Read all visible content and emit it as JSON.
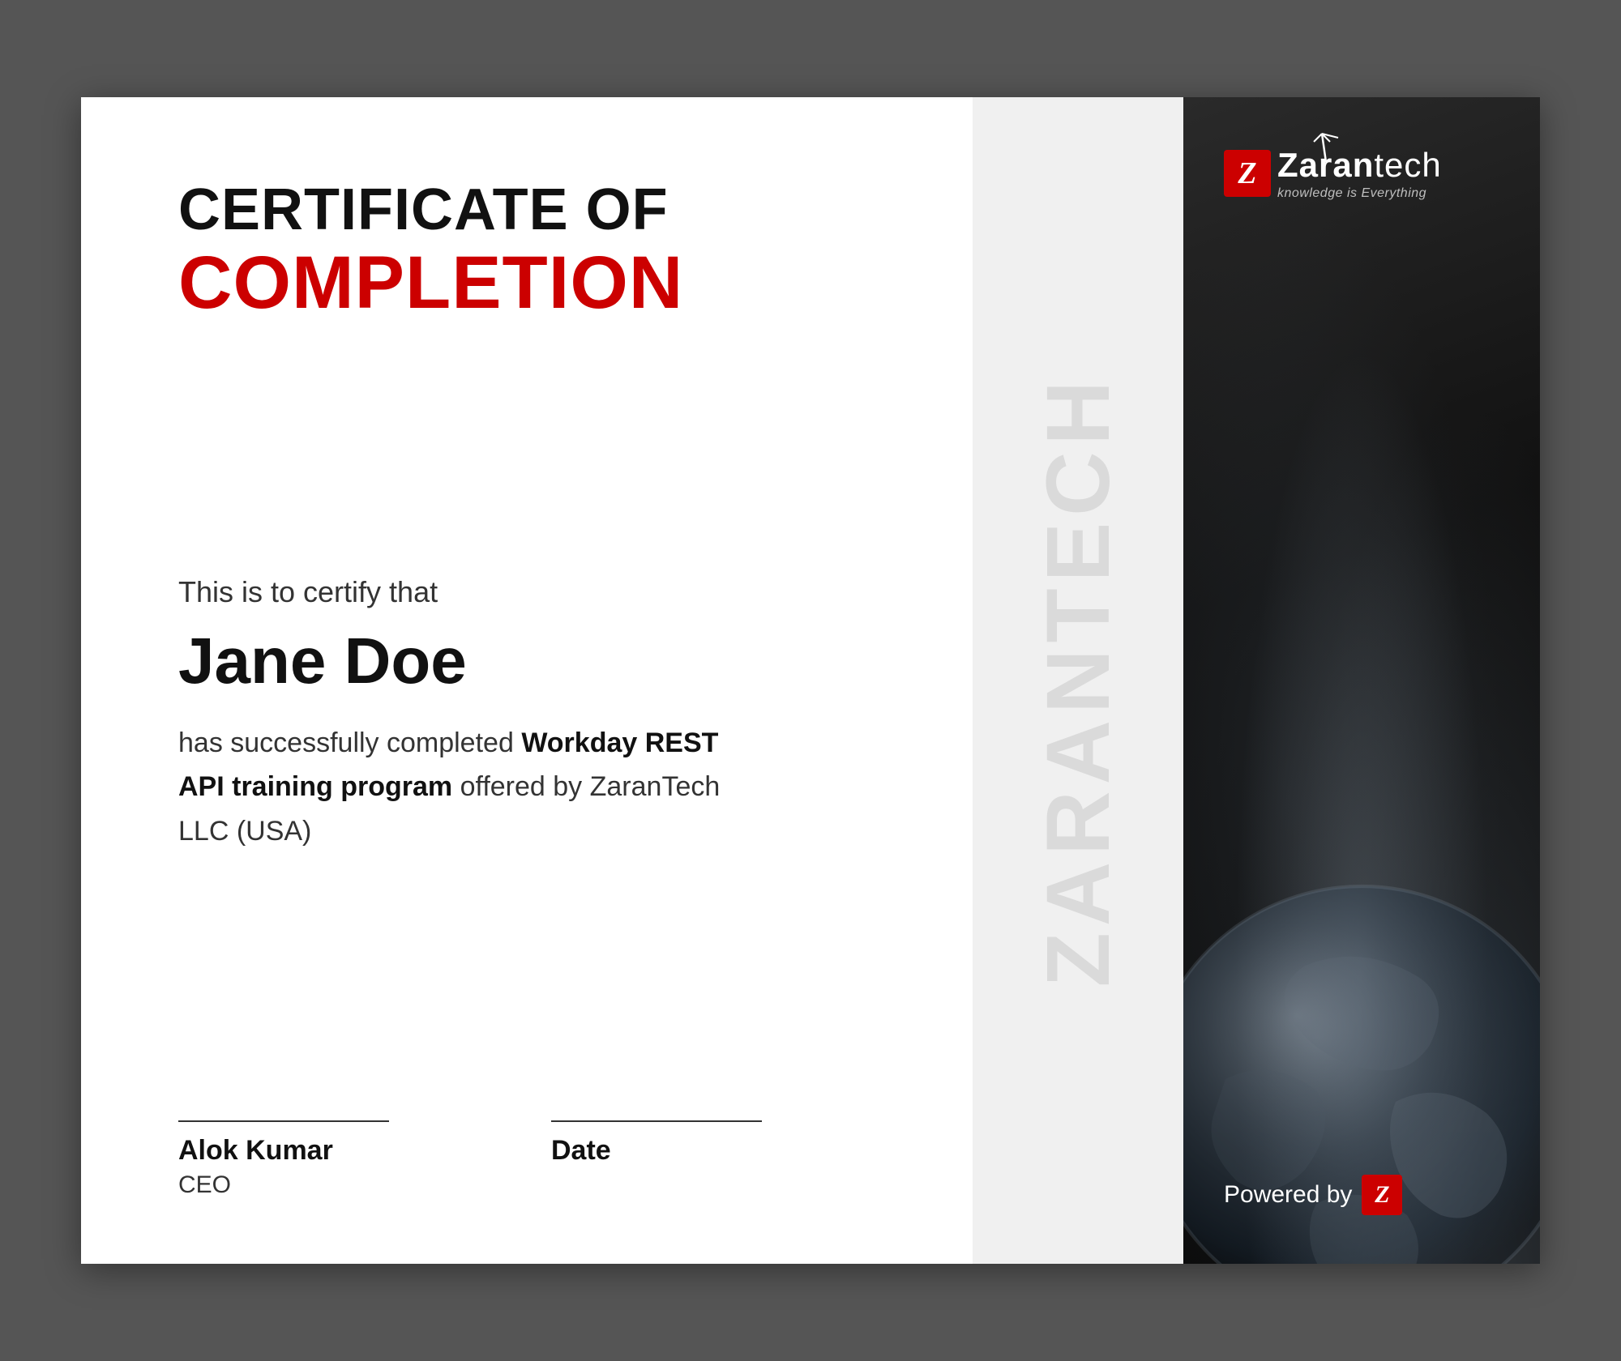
{
  "certificate": {
    "title_line1": "CERTIFICATE OF",
    "title_line2": "COMPLETION",
    "certify_text": "This is to certify that",
    "recipient_name": "Jane Doe",
    "description_prefix": "has successfully completed ",
    "course_name": "Workday REST API training program",
    "description_suffix": " offered by ZaranTech LLC (USA)",
    "watermark_text": "ZARANTECH",
    "signature": {
      "signer_name": "Alok Kumar",
      "signer_title": "CEO",
      "date_label": "Date"
    },
    "logo": {
      "brand_part1": "Zaran",
      "brand_part2": "tech",
      "tagline": "knowledge is Everything",
      "powered_by_text": "Powered by"
    }
  }
}
